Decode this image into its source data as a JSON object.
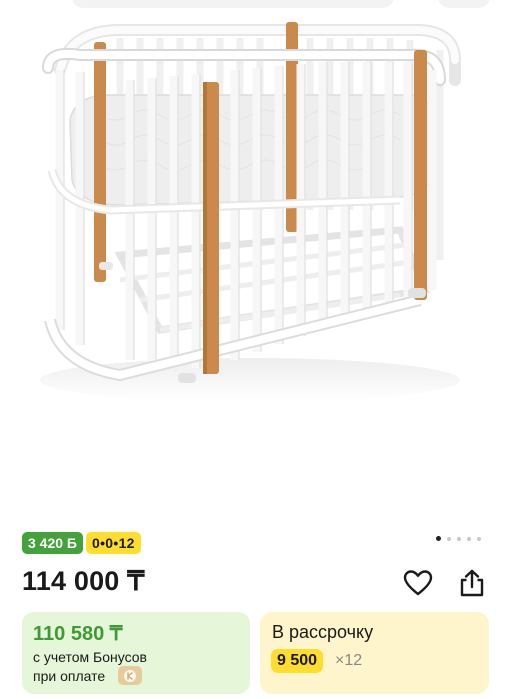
{
  "product": {
    "image_alt": "oval-crib",
    "badges": {
      "bonus": "3 420 Б",
      "installment": "0•0•12"
    },
    "carousel": {
      "count": 5,
      "active_index": 0
    },
    "price": "114 000 ₸"
  },
  "bonus_card": {
    "price": "110 580 ₸",
    "note_line1": "с учетом Бонусов",
    "note_line2": "при оплате"
  },
  "installment_card": {
    "title": "В рассрочку",
    "amount": "9 500",
    "months": "×12"
  },
  "colors": {
    "bonus_green": "#43a33a",
    "installment_yellow": "#ffdd2d",
    "bonus_card_bg": "#e6f6d9",
    "installment_card_bg": "#fff5cc",
    "wood": "#c98a4b"
  },
  "icons": {
    "favorite": "heart-icon",
    "share": "share-icon",
    "bonus_coin": "kaspi-coin-icon"
  }
}
